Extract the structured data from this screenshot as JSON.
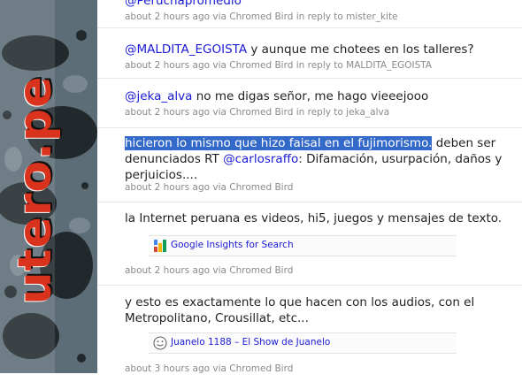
{
  "sidebar": {
    "logo_text": "utero.pe"
  },
  "tweets": [
    {
      "mention": "@Peruchapromedio",
      "text": "",
      "meta": "about 2 hours ago via Chromed Bird in reply to mister_kite"
    },
    {
      "mention": "@MALDITA_EGOISTA",
      "text": " y aunque me chotees en los talleres?",
      "meta": "about 2 hours ago via Chromed Bird in reply to MALDITA_EGOISTA"
    },
    {
      "mention": "@jeka_alva",
      "text": " no me digas señor, me hago vieeejooo",
      "meta": "about 2 hours ago via Chromed Bird in reply to jeka_alva"
    },
    {
      "highlight": "hicieron lo mismo que hizo faisal en el fujimorismo.",
      "text_a": " deben ser denunciados RT ",
      "mention": "@carlosraffo",
      "text_b": ": Difamación, usurpación, daños y perjuicios....",
      "meta": "about 2 hours ago via Chromed Bird"
    },
    {
      "text": "la Internet peruana es videos, hi5, juegos y mensajes de texto.",
      "attachment": "Google Insights for Search",
      "meta": "about 2 hours ago via Chromed Bird"
    },
    {
      "text": "y esto es exactamente lo que hacen con los audios, con el Metropolitano, Crousillat, etc...",
      "attachment": "Juanelo 1188 – El Show de Juanelo",
      "meta": "about 3 hours ago via Chromed Bird"
    }
  ],
  "colors": {
    "mention": "#1a1ad6",
    "meta": "#8a8a8a",
    "highlight_bg": "#3369c9",
    "sidebar_bg": "#5d6d77",
    "logo_red": "#d9331e"
  },
  "icons": [
    "google-insights-icon",
    "smiley-icon"
  ]
}
